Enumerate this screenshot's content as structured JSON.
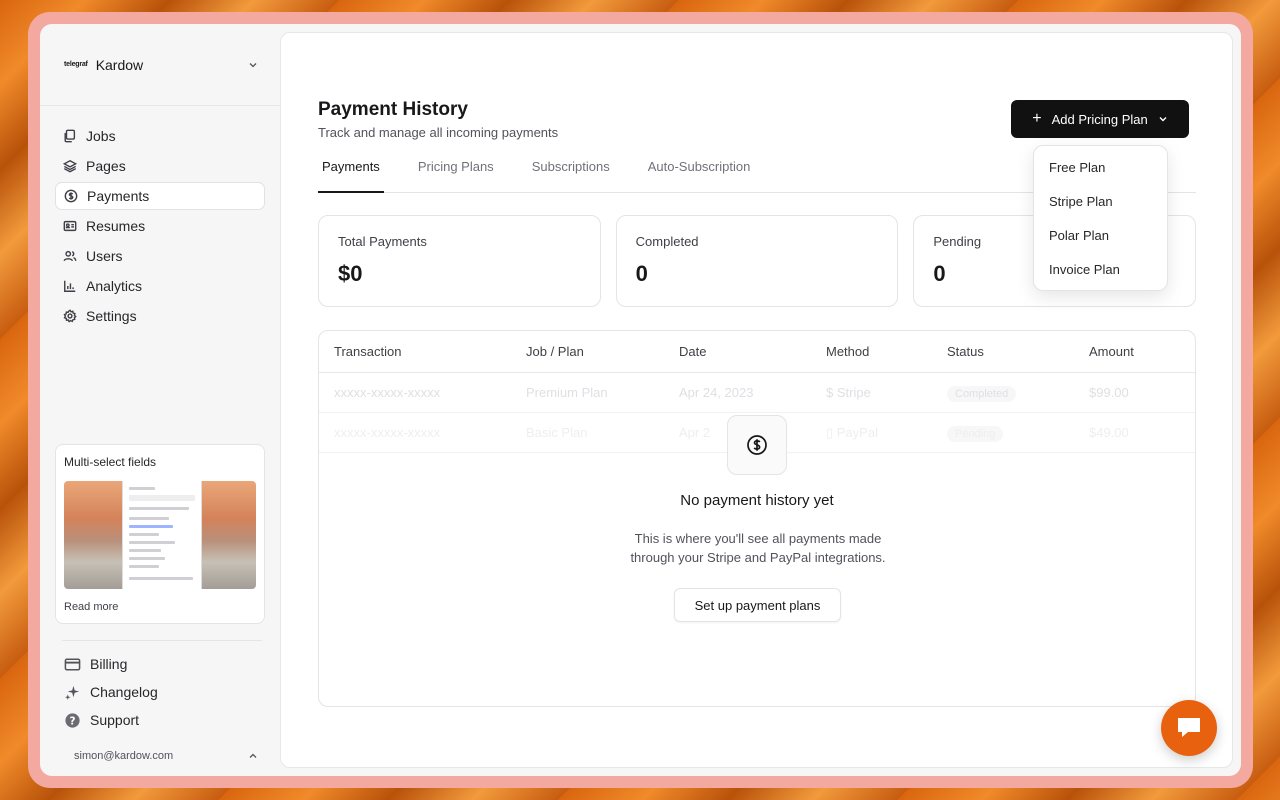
{
  "workspace": {
    "logo": "telegraf",
    "name": "Kardow"
  },
  "nav": [
    {
      "label": "Jobs",
      "icon": "files-icon"
    },
    {
      "label": "Pages",
      "icon": "layers-icon"
    },
    {
      "label": "Payments",
      "icon": "dollar-circle-icon",
      "active": true
    },
    {
      "label": "Resumes",
      "icon": "id-card-icon"
    },
    {
      "label": "Users",
      "icon": "users-icon"
    },
    {
      "label": "Analytics",
      "icon": "bar-chart-icon"
    },
    {
      "label": "Settings",
      "icon": "gear-icon"
    }
  ],
  "promo": {
    "title": "Multi-select fields",
    "link": "Read more"
  },
  "bottom_nav": [
    {
      "label": "Billing",
      "icon": "credit-card-icon"
    },
    {
      "label": "Changelog",
      "icon": "sparkles-icon"
    },
    {
      "label": "Support",
      "icon": "help-circle-icon"
    }
  ],
  "user": {
    "email": "simon@kardow.com"
  },
  "page": {
    "title": "Payment History",
    "subtitle": "Track and manage all incoming payments",
    "add_button": "Add Pricing Plan"
  },
  "tabs": [
    "Payments",
    "Pricing Plans",
    "Subscriptions",
    "Auto-Subscription"
  ],
  "stats": [
    {
      "label": "Total Payments",
      "value": "$0"
    },
    {
      "label": "Completed",
      "value": "0"
    },
    {
      "label": "Pending",
      "value": "0"
    }
  ],
  "table": {
    "headers": [
      "Transaction",
      "Job / Plan",
      "Date",
      "Method",
      "Status",
      "Amount"
    ],
    "ghost_rows": [
      [
        "xxxxx-xxxxx-xxxxx",
        "Premium Plan",
        "Apr 24, 2023",
        "Stripe",
        "Completed",
        "$99.00"
      ],
      [
        "xxxxx-xxxxx-xxxxx",
        "Basic Plan",
        "Apr 2",
        "PayPal",
        "Pending",
        "$49.00"
      ]
    ]
  },
  "empty": {
    "title": "No payment history yet",
    "desc_line1": "This is where you'll see all payments made",
    "desc_line2": "through your Stripe and PayPal integrations.",
    "button": "Set up payment plans"
  },
  "dropdown": [
    "Free Plan",
    "Stripe Plan",
    "Polar Plan",
    "Invoice Plan"
  ],
  "colors": {
    "accent": "#111111",
    "chat": "#e8610f",
    "frame": "#f4a9a0"
  }
}
